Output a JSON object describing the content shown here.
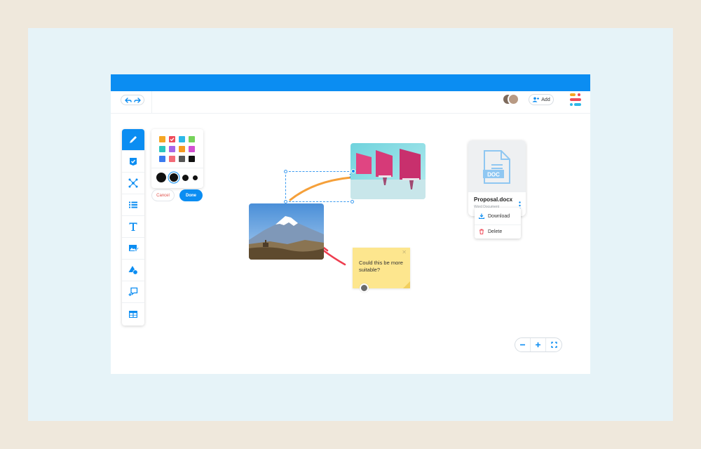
{
  "toolbar": {
    "add_label": "Add"
  },
  "tools": [
    {
      "name": "pencil-icon"
    },
    {
      "name": "task-icon"
    },
    {
      "name": "mind-map-icon"
    },
    {
      "name": "list-icon"
    },
    {
      "name": "text-icon"
    },
    {
      "name": "image-edit-icon"
    },
    {
      "name": "shapes-icon"
    },
    {
      "name": "comment-add-icon"
    },
    {
      "name": "table-icon"
    }
  ],
  "colors": [
    "#f5a623",
    "#ef4b5a",
    "#2db8e8",
    "#76d35a",
    "#2bc6c0",
    "#a765e8",
    "#f79a22",
    "#d44fd1",
    "#3a7bf0",
    "#f36b78",
    "#555555",
    "#111111"
  ],
  "palette_actions": {
    "cancel": "Cancel",
    "done": "Done"
  },
  "sticky_note": {
    "text": "Could this be more suitable?"
  },
  "file_card": {
    "file_name": "Proposal.docx",
    "file_type": "Word Document",
    "badge": "DOC",
    "menu": {
      "download": "Download",
      "delete": "Delete"
    }
  },
  "accent_color": "#0b8df2"
}
